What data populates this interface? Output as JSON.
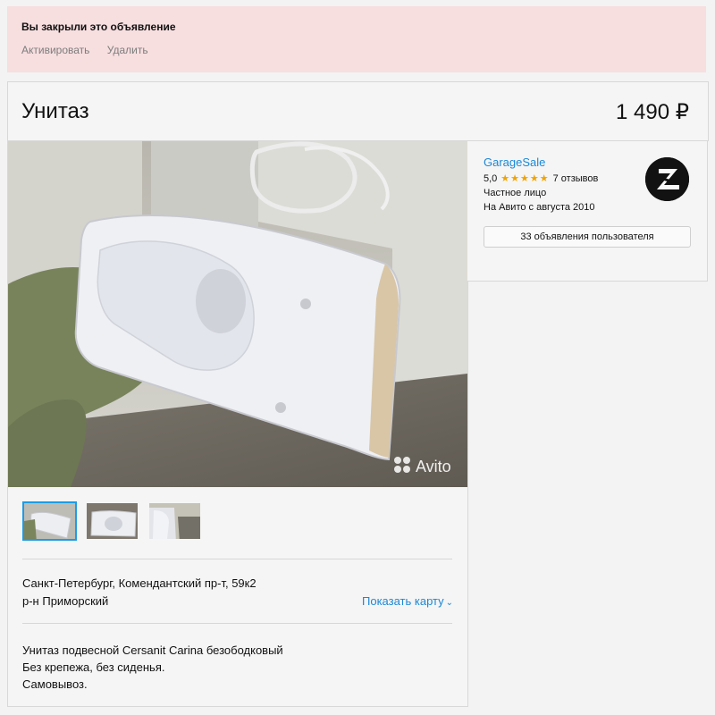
{
  "banner": {
    "title": "Вы закрыли это объявление",
    "actions": [
      "Активировать",
      "Удалить"
    ]
  },
  "item": {
    "title": "Унитаз",
    "price": "1 490 ₽",
    "gallery": {
      "watermark": "Avito",
      "thumbnails_count": 3,
      "selected_index": 0
    },
    "location": {
      "address": "Санкт-Петербург, Комендантский пр-т, 59к2",
      "district": "р-н Приморский",
      "map_link": "Показать карту"
    },
    "description": [
      "Унитаз подвесной Cersanit Carina безободковый",
      "Без крепежа, без сиденья.",
      "Самовывоз."
    ]
  },
  "seller": {
    "name": "GarageSale",
    "rating": "5,0",
    "stars": "★★★★★",
    "reviews": "7 отзывов",
    "type": "Частное лицо",
    "since": "На Авито с августа 2010",
    "listings_button": "33 объявления пользователя"
  },
  "colors": {
    "page_bg": "#f3f3f3",
    "banner_bg": "#f7dedf",
    "link_blue": "#1b88d7",
    "thumb_active": "#1c9ce7",
    "star_orange": "#f0a400"
  }
}
